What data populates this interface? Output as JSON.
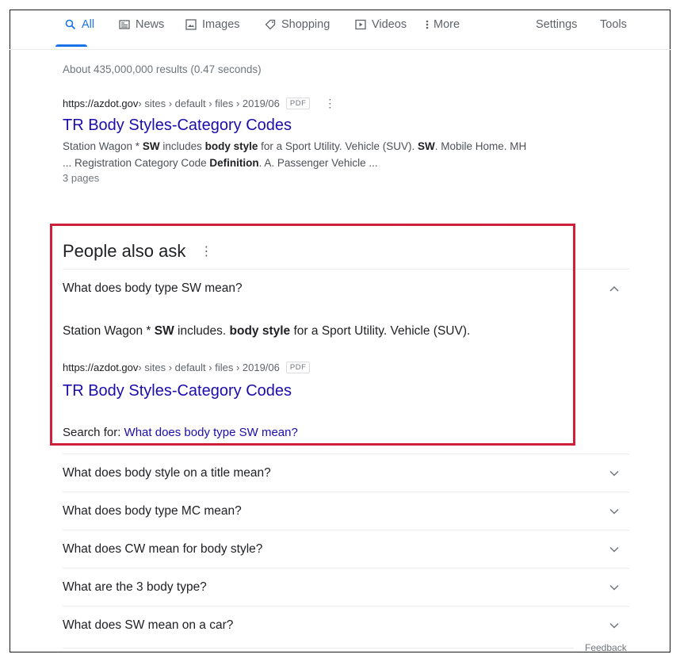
{
  "tabs": [
    {
      "label": "All",
      "icon": "search-icon"
    },
    {
      "label": "News",
      "icon": "news-icon"
    },
    {
      "label": "Images",
      "icon": "image-icon"
    },
    {
      "label": "Shopping",
      "icon": "tag-icon"
    },
    {
      "label": "Videos",
      "icon": "play-icon"
    },
    {
      "label": "More",
      "icon": "kebab-icon"
    }
  ],
  "tab_settings": "Settings",
  "tab_tools": "Tools",
  "stats": "About 435,000,000 results (0.47 seconds)",
  "result": {
    "domain": "https://azdot.gov",
    "path": " › sites › default › files › 2019/06",
    "badge": "PDF",
    "title": "TR Body Styles-Category Codes",
    "snippet_1a": "Station Wagon * ",
    "snippet_1b": "SW",
    "snippet_1c": " includes ",
    "snippet_1d": "body style",
    "snippet_1e": " for a Sport Utility. Vehicle (SUV). ",
    "snippet_1f": "SW",
    "snippet_1g": ". Mobile Home. MH",
    "snippet_2a": "... Registration Category Code ",
    "snippet_2b": "Definition",
    "snippet_2c": ". A. Passenger Vehicle ...",
    "meta": "3 pages"
  },
  "paa": {
    "heading": "People also ask",
    "expanded_question": "What does body type SW mean?",
    "answer_a": "Station Wagon * ",
    "answer_b": "SW",
    "answer_c": " includes. ",
    "answer_d": "body style",
    "answer_e": " for a Sport Utility. Vehicle (SUV).",
    "source_domain": "https://azdot.gov",
    "source_path": " › sites › default › files › 2019/06",
    "source_badge": "PDF",
    "source_title": "TR Body Styles-Category Codes",
    "search_for_label": "Search for: ",
    "search_for_link": "What does body type SW mean?",
    "questions": [
      "What does body style on a title mean?",
      "What does body type MC mean?",
      "What does CW mean for body style?",
      "What are the 3 body type?",
      "What does SW mean on a car?"
    ]
  },
  "feedback": "Feedback",
  "colors": {
    "accent": "#1a73e8",
    "link": "#1a0dab",
    "highlight_box": "#d0203a"
  }
}
